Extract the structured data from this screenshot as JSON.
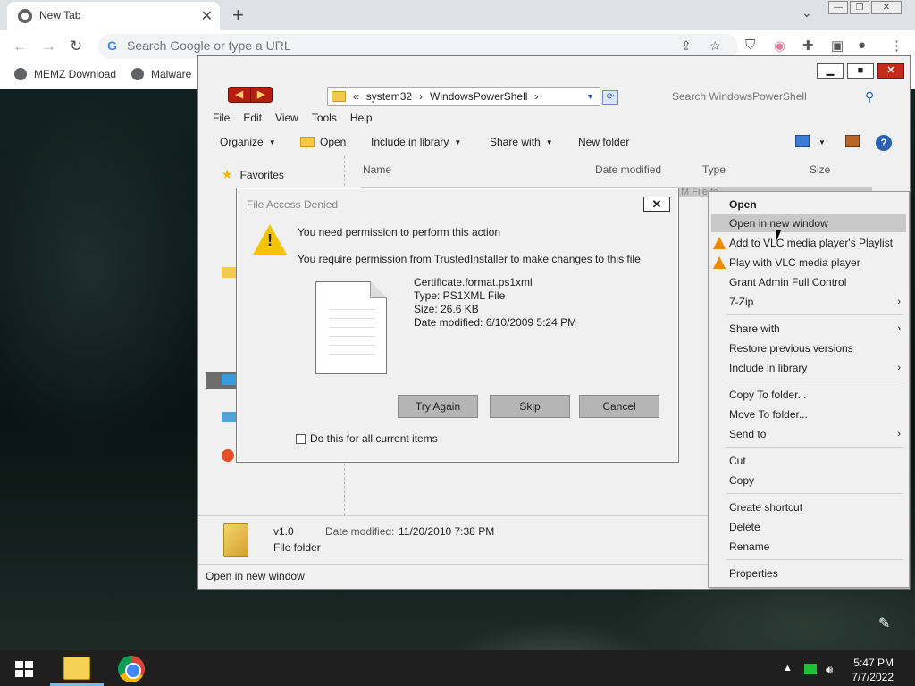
{
  "chrome": {
    "tab_title": "New Tab",
    "omnibox_placeholder": "Search Google or type a URL",
    "bookmarks": [
      "MEMZ Download",
      "Malware"
    ]
  },
  "explorer": {
    "breadcrumb": [
      "«",
      "system32",
      "›",
      "WindowsPowerShell",
      "›"
    ],
    "search_placeholder": "Search WindowsPowerShell",
    "menu": [
      "File",
      "Edit",
      "View",
      "Tools",
      "Help"
    ],
    "commands": {
      "organize": "Organize",
      "open": "Open",
      "include_in_library": "Include in library",
      "share_with": "Share with",
      "new_folder": "New folder"
    },
    "nav": {
      "favorites": "Favorites"
    },
    "columns": [
      "Name",
      "Date modified",
      "Type",
      "Size"
    ],
    "row_hint": "M    File fo",
    "details": {
      "name": "v1.0",
      "date_label": "Date modified:",
      "date_value": "11/20/2010 7:38 PM",
      "type": "File folder"
    },
    "status": "Open in new window"
  },
  "dialog": {
    "title": "File Access Denied",
    "message1": "You need permission to perform this action",
    "message2": "You require permission from TrustedInstaller to make changes to this file",
    "file": {
      "name": "Certificate.format.ps1xml",
      "type": "Type: PS1XML File",
      "size": "Size: 26.6 KB",
      "date": "Date modified: 6/10/2009 5:24 PM"
    },
    "buttons": {
      "try_again": "Try Again",
      "skip": "Skip",
      "cancel": "Cancel"
    },
    "checkbox_label": "Do this for all current items"
  },
  "context_menu": {
    "items": [
      "Open",
      "Open in new window",
      "Add to VLC media player's Playlist",
      "Play with VLC media player",
      "Grant Admin Full Control",
      "7-Zip",
      "Share with",
      "Restore previous versions",
      "Include in library",
      "Copy To folder...",
      "Move To folder...",
      "Send to",
      "Cut",
      "Copy",
      "Create shortcut",
      "Delete",
      "Rename",
      "Properties"
    ]
  },
  "taskbar": {
    "time": "5:47 PM",
    "date": "7/7/2022"
  }
}
